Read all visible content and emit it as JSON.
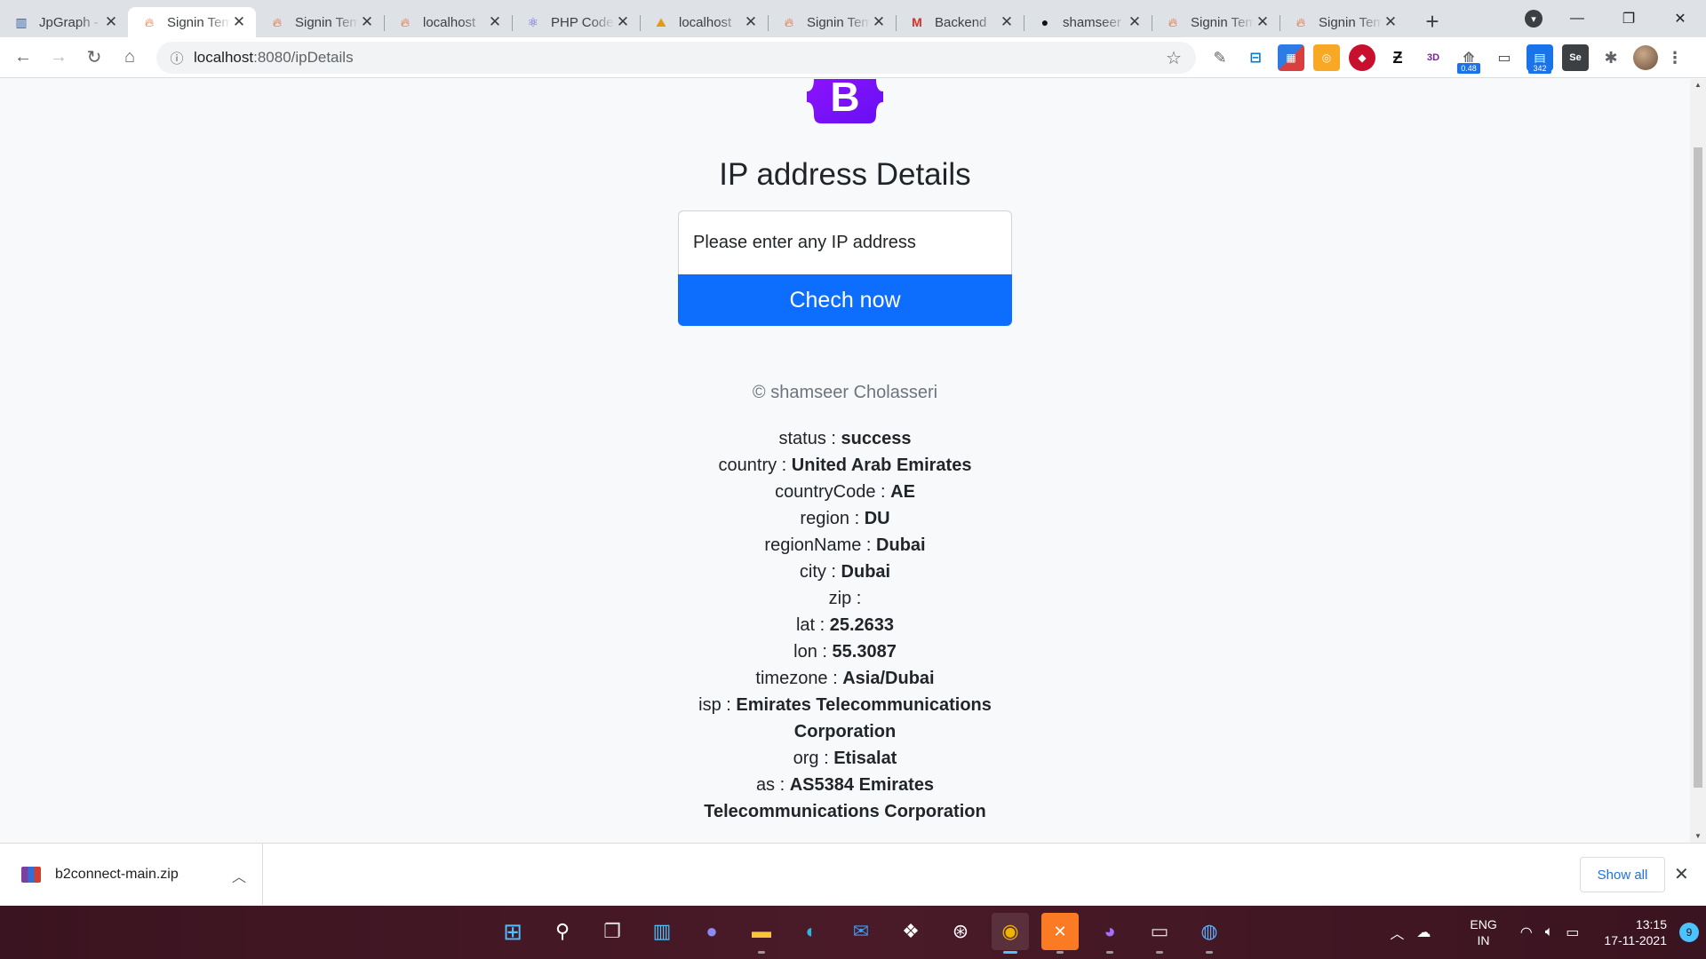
{
  "browser": {
    "tabs": [
      {
        "title": "JpGraph -",
        "icon": "jpgraph-icon",
        "active": false
      },
      {
        "title": "Signin Template",
        "icon": "fire-icon",
        "active": true
      },
      {
        "title": "Signin Template",
        "icon": "fire-icon",
        "active": false
      },
      {
        "title": "localhost",
        "icon": "fire-icon",
        "active": false
      },
      {
        "title": "PHP Code",
        "icon": "react-icon",
        "active": false
      },
      {
        "title": "localhost",
        "icon": "phpmyadmin-icon",
        "active": false
      },
      {
        "title": "Signin Template",
        "icon": "fire-icon",
        "active": false
      },
      {
        "title": "Backend",
        "icon": "gmail-icon",
        "active": false
      },
      {
        "title": "shamseer",
        "icon": "github-icon",
        "active": false
      },
      {
        "title": "Signin Template",
        "icon": "fire-icon",
        "active": false
      },
      {
        "title": "Signin Template",
        "icon": "fire-icon",
        "active": false
      }
    ],
    "address": {
      "host": "localhost",
      "rest": ":8080/ipDetails"
    },
    "extension_badges": {
      "first": "0.48",
      "second": "342"
    }
  },
  "page": {
    "heading": "IP address Details",
    "input_placeholder": "Please enter any IP address",
    "button_label": "Chech now",
    "copyright": "© shamseer Cholasseri",
    "details": [
      {
        "key": "status",
        "value": "success"
      },
      {
        "key": "country",
        "value": "United Arab Emirates"
      },
      {
        "key": "countryCode",
        "value": "AE"
      },
      {
        "key": "region",
        "value": "DU"
      },
      {
        "key": "regionName",
        "value": "Dubai"
      },
      {
        "key": "city",
        "value": "Dubai"
      },
      {
        "key": "zip",
        "value": ""
      },
      {
        "key": "lat",
        "value": "25.2633"
      },
      {
        "key": "lon",
        "value": "55.3087"
      },
      {
        "key": "timezone",
        "value": "Asia/Dubai"
      },
      {
        "key": "isp",
        "value": "Emirates Telecommunications Corporation"
      },
      {
        "key": "org",
        "value": "Etisalat"
      },
      {
        "key": "as",
        "value": "AS5384 Emirates Telecommunications Corporation"
      }
    ]
  },
  "downloads": {
    "filename": "b2connect-main.zip",
    "show_all": "Show all"
  },
  "taskbar": {
    "lang_line1": "ENG",
    "lang_line2": "IN",
    "time": "13:15",
    "date": "17-11-2021",
    "notification_count": "9"
  },
  "colors": {
    "primary_button": "#0d6efd",
    "bootstrap_purple": "#7952b3"
  }
}
